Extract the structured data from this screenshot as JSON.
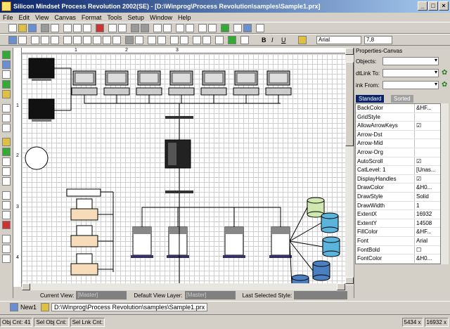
{
  "window": {
    "title": "Silicon Mindset Process Revolution 2002(SE) - [D:\\Winprog\\Process Revolution\\samples\\Sample1.prx]"
  },
  "menu": [
    "File",
    "Edit",
    "View",
    "Canvas",
    "Format",
    "Tools",
    "Setup",
    "Window",
    "Help"
  ],
  "format_toolbar": {
    "bold": "B",
    "italic": "I",
    "underline": "U",
    "font": "Arial",
    "size": "7,8"
  },
  "ruler": {
    "h": [
      "1",
      "2",
      "3"
    ],
    "v": [
      "1",
      "2",
      "3",
      "4"
    ]
  },
  "view_bar": {
    "current_view_label": "Current View:",
    "current_view": "[Master]",
    "default_layer_label": "Default View Layer:",
    "default_layer": "[Master]",
    "last_style_label": "Last Selected Style:",
    "last_style": ""
  },
  "panel": {
    "title": "Properties-Canvas",
    "objects_label": "Objects:",
    "dtlink_label": "dtLink To:",
    "ink_label": "ink From:",
    "tab_standard": "Standard",
    "tab_sorted": "Sorted",
    "props": [
      {
        "k": "BackColor",
        "v": "&HF..."
      },
      {
        "k": "GridStyle",
        "v": ""
      },
      {
        "k": "AllowArrowKeys",
        "v": "☑"
      },
      {
        "k": "Arrow-Dst",
        "v": ""
      },
      {
        "k": "Arrow-Mid",
        "v": ""
      },
      {
        "k": "Arrow-Org",
        "v": ""
      },
      {
        "k": "AutoScroll",
        "v": "☑"
      },
      {
        "k": "CatLevel: 1",
        "v": "[Unas..."
      },
      {
        "k": "DisplayHandles",
        "v": "☑"
      },
      {
        "k": "DrawColor",
        "v": "&H0..."
      },
      {
        "k": "DrawStyle",
        "v": "Solid"
      },
      {
        "k": "DrawWidth",
        "v": "1"
      },
      {
        "k": "ExtentX",
        "v": "16932"
      },
      {
        "k": "ExtentY",
        "v": "14508"
      },
      {
        "k": "FillColor",
        "v": "&HF..."
      },
      {
        "k": "Font",
        "v": "Arial"
      },
      {
        "k": "FontBold",
        "v": "☐"
      },
      {
        "k": "FontColor",
        "v": "&H0..."
      }
    ]
  },
  "doc_tabs": {
    "new_label": "New1",
    "path": "D:\\Winprog\\Process Revolution\\samples\\Sample1.prx"
  },
  "status": {
    "obj_cnt": "Obj Cnt: 41",
    "sel_obj": "Sel Obj Cnt:",
    "sel_lnk": "Sel Lnk Cnt:",
    "coord_x": "5434 x",
    "coord_y": "16932 x"
  }
}
